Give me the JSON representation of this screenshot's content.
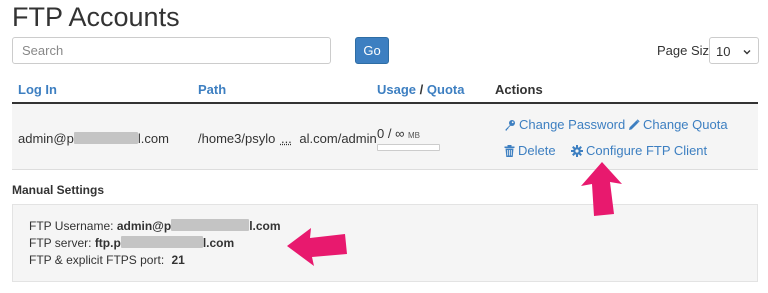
{
  "page": {
    "title": "FTP Accounts"
  },
  "search": {
    "placeholder": "Search",
    "go_label": "Go"
  },
  "pagesize": {
    "label": "Page Size",
    "value": "10"
  },
  "table": {
    "headers": {
      "login": "Log In",
      "path": "Path",
      "usage": "Usage",
      "slash": "/",
      "quota": "Quota",
      "actions": "Actions"
    },
    "rows": [
      {
        "login_pre": "admin@p",
        "login_post": "l.com",
        "path_pre": "/home3/psylo",
        "path_ellipsis": "...",
        "path_post": "al.com/admin",
        "usage": "0 / ∞",
        "usage_unit": "MB",
        "usage_fraction": 0,
        "actions": {
          "change_password": "Change Password",
          "change_quota": "Change Quota",
          "delete": "Delete",
          "configure": "Configure FTP Client"
        }
      }
    ]
  },
  "manual": {
    "title": "Manual Settings",
    "username_label": "FTP Username:",
    "username_pre": "admin@p",
    "username_post": "l.com",
    "server_label": "FTP server:",
    "server_pre": "ftp.p",
    "server_post": "l.com",
    "port_label": "FTP & explicit FTPS port:",
    "port_value": "21"
  },
  "colors": {
    "link": "#3d7fc1",
    "arrow": "#e8196e",
    "row_bg": "#f5f5f5"
  },
  "icons": [
    "key-icon",
    "pencil-icon",
    "trash-icon",
    "gear-icon",
    "chevron-down-icon",
    "pointer-arrow-icon"
  ]
}
